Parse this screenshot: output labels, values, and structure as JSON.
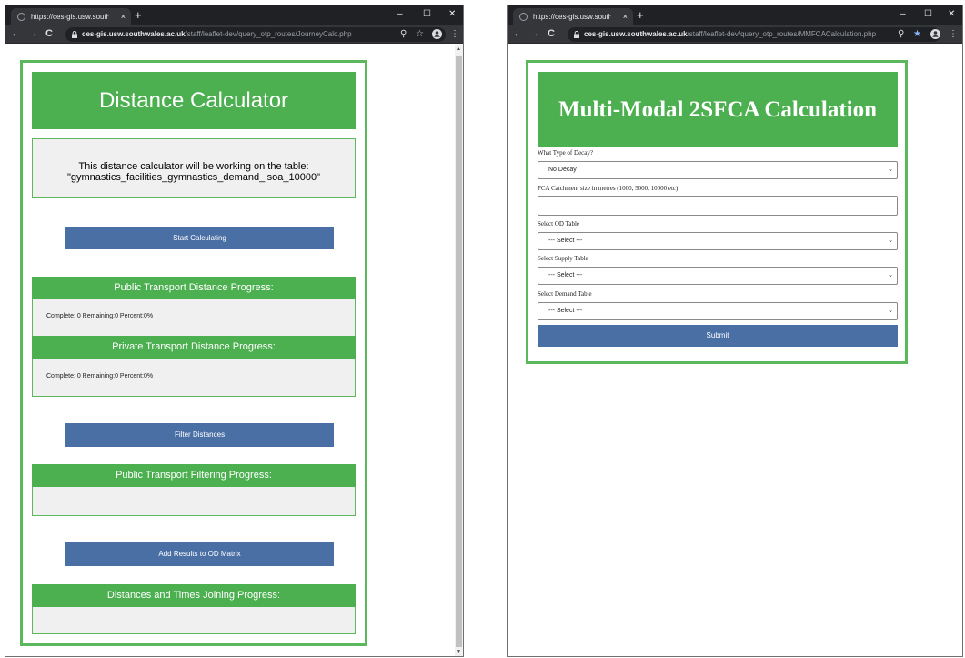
{
  "left_window": {
    "tab_title": "https://ces-gis.usw.southwales",
    "url_host": "ces-gis.usw.southwales.ac.uk",
    "url_path": "/staff/leaflet-dev/query_otp_routes/JourneyCalc.php",
    "page": {
      "title": "Distance Calculator",
      "info_line1": "This distance calculator will be working on the table:",
      "info_line2": "\"gymnastics_facilities_gymnastics_demand_lsoa_10000\"",
      "start_button": "Start Calculating",
      "pt_distance_heading": "Public Transport Distance Progress:",
      "pt_distance_status": "Complete: 0 Remaining:0 Percent:0%",
      "private_distance_heading": "Private Transport Distance Progress:",
      "private_distance_status": "Complete: 0 Remaining:0 Percent:0%",
      "filter_button": "Filter Distances",
      "pt_filtering_heading": "Public Transport Filtering Progress:",
      "add_results_button": "Add Results to OD Matrix",
      "joining_heading": "Distances and Times Joining Progress:"
    }
  },
  "right_window": {
    "tab_title": "https://ces-gis.usw.southwales.ac",
    "url_host": "ces-gis.usw.southwales.ac.uk",
    "url_path": "/staff/leaflet-dev/query_otp_routes/MMFCACalculation.php",
    "page": {
      "title": "Multi-Modal 2SFCA Calculation",
      "decay_label": "What Type of Decay?",
      "decay_value": "No Decay",
      "catchment_label": "FCA Catchment size in metres (1000, 5000, 10000 etc)",
      "catchment_value": "",
      "od_label": "Select OD Table",
      "od_value": "--- Select ---",
      "supply_label": "Select Supply Table",
      "supply_value": "--- Select ---",
      "demand_label": "Select Demand Table",
      "demand_value": "--- Select ---",
      "submit_button": "Submit"
    }
  },
  "icons": {
    "tab_close": "×",
    "new_tab": "+",
    "minimize": "–",
    "maximize": "☐",
    "close": "✕",
    "back": "←",
    "forward": "→",
    "reload": "C",
    "zoom": "⚲",
    "bookmark_empty": "☆",
    "bookmark_filled": "★",
    "menu": "⋮",
    "dropdown": "⌄"
  },
  "colors": {
    "accent_green": "#4caf50",
    "button_blue": "#4a6fa5",
    "panel_gray": "#f0f0f0",
    "chrome_dark": "#202124",
    "bookmark_blue": "#8ab4f8"
  }
}
